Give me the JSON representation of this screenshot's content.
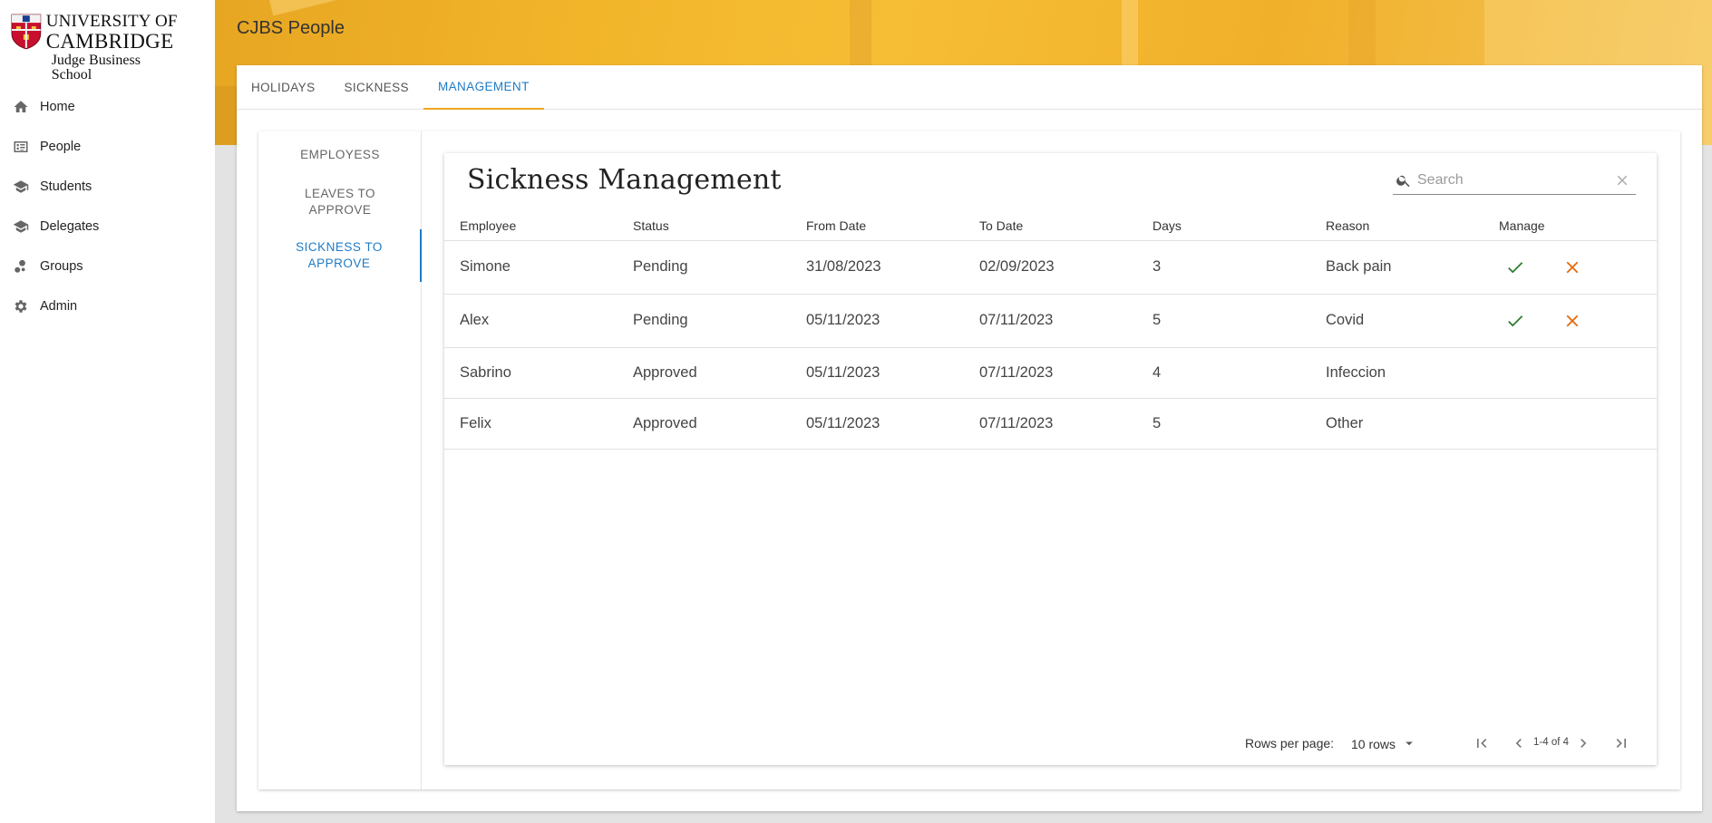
{
  "logo": {
    "line1": "UNIVERSITY OF",
    "line2": "CAMBRIDGE",
    "line3": "Judge Business School"
  },
  "sidebar": {
    "items": [
      {
        "label": "Home",
        "icon": "home-icon"
      },
      {
        "label": "People",
        "icon": "contacts-icon"
      },
      {
        "label": "Students",
        "icon": "school-icon"
      },
      {
        "label": "Delegates",
        "icon": "school-icon"
      },
      {
        "label": "Groups",
        "icon": "bubbles-icon"
      },
      {
        "label": "Admin",
        "icon": "gear-icon"
      }
    ]
  },
  "header": {
    "title": "CJBS People"
  },
  "tabs": [
    {
      "label": "HOLIDAYS",
      "active": false
    },
    {
      "label": "SICKNESS",
      "active": false
    },
    {
      "label": "MANAGEMENT",
      "active": true
    }
  ],
  "subnav": {
    "items": [
      {
        "label": "EMPLOYESS",
        "active": false
      },
      {
        "label": "LEAVES TO APPROVE",
        "active": false
      },
      {
        "label": "SICKNESS TO APPROVE",
        "active": true
      }
    ]
  },
  "panel": {
    "title": "Sickness Management",
    "search": {
      "placeholder": "Search",
      "value": ""
    }
  },
  "table": {
    "columns": [
      "Employee",
      "Status",
      "From Date",
      "To Date",
      "Days",
      "Reason",
      "Manage"
    ],
    "rows": [
      {
        "employee": "Simone",
        "status": "Pending",
        "from": "31/08/2023",
        "to": "02/09/2023",
        "days": "3",
        "reason": "Back pain",
        "actions": true
      },
      {
        "employee": "Alex",
        "status": "Pending",
        "from": "05/11/2023",
        "to": "07/11/2023",
        "days": "5",
        "reason": "Covid",
        "actions": true
      },
      {
        "employee": "Sabrino",
        "status": "Approved",
        "from": "05/11/2023",
        "to": "07/11/2023",
        "days": "4",
        "reason": "Infeccion",
        "actions": false
      },
      {
        "employee": "Felix",
        "status": "Approved",
        "from": "05/11/2023",
        "to": "07/11/2023",
        "days": "5",
        "reason": "Other",
        "actions": false
      }
    ]
  },
  "pagination": {
    "rows_per_page_label": "Rows per page:",
    "rows_per_page_value": "10 rows",
    "range": "1-4 of 4"
  },
  "colors": {
    "accent_blue": "#1e7bc6",
    "tab_underline": "#f0a51c",
    "approve": "#2e7d32",
    "reject": "#e36a0c",
    "banner": "#f2b52a"
  }
}
